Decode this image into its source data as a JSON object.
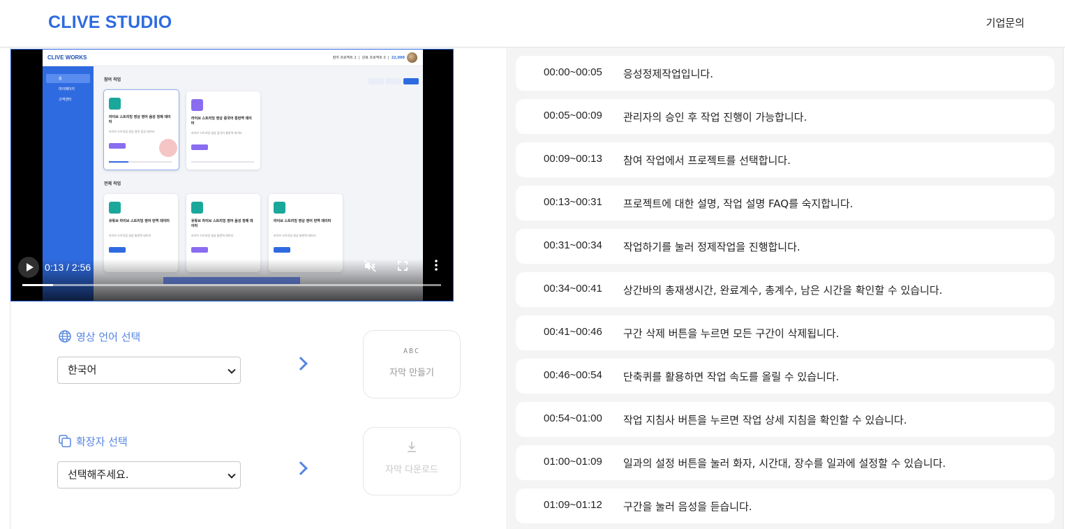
{
  "header": {
    "logo": "CLIVE STUDIO",
    "nav_link": "기업문의"
  },
  "video": {
    "current_time": "0:13",
    "duration": "2:56",
    "time_display": "0:13 / 2:56",
    "progress": 0.074,
    "muted": true,
    "frame": {
      "app_logo": "CLIVE WORKS",
      "top_right": [
        "참여 프로젝트 2",
        "완료 프로젝트 0"
      ],
      "credits": "22,000",
      "sidebar": [
        "홈",
        "마이페이지",
        "고객센터"
      ],
      "section_joined": "참여 작업",
      "section_all": "전체 작업",
      "cards": [
        {
          "title": "라이브 스트리밍 영상 영어 음성 정제 데이터",
          "desc": "라이브 스트리밍 영상 영어 음성 데이터",
          "progress": "31%"
        },
        {
          "title": "라이브 스트리밍 영상 중국어 통번역 데이터",
          "desc": "라이브 스트리밍 영상 중국어 통번역 데이터",
          "progress": "0%"
        },
        {
          "title": "유튜브 라이브 스트리밍 영어 번역 데이터",
          "desc": "라이브 스트리밍 영상 통번역 데이터",
          "progress": "0%"
        },
        {
          "title": "유튜브 라이브 스트리밍 영어 음성 정제 데이터",
          "desc": "라이브 스트리밍 영상 통번역 데이터",
          "progress": "0%"
        },
        {
          "title": "라이브 스트리밍 영상 영어 번역 데이터",
          "desc": "라이브 스트리밍 영상 통번역 데이터",
          "progress": "1%"
        }
      ]
    }
  },
  "language": {
    "label": "영상 언어 선택",
    "selected": "한국어"
  },
  "extension": {
    "label": "확장자 선택",
    "selected": "선택해주세요."
  },
  "actions": {
    "make": {
      "badge": "ABC",
      "label": "자막 만들기"
    },
    "download": {
      "label": "자막 다운로드"
    }
  },
  "subtitles": [
    {
      "time": "00:00~00:05",
      "text": "응성정제작업입니다."
    },
    {
      "time": "00:05~00:09",
      "text": "관리자의 승인 후 작업 진행이 가능합니다."
    },
    {
      "time": "00:09~00:13",
      "text": "참여 작업에서 프로젝트를 선택합니다."
    },
    {
      "time": "00:13~00:31",
      "text": "프로젝트에 대한 설명, 작업 설명 FAQ를 숙지합니다."
    },
    {
      "time": "00:31~00:34",
      "text": "작업하기를 눌러 정제작업을 진행합니다."
    },
    {
      "time": "00:34~00:41",
      "text": "상간바의 총재생시간, 완료계수, 총계수, 남은 시간을 확인할 수 있습니다."
    },
    {
      "time": "00:41~00:46",
      "text": "구간 삭제 버튼을 누르면 모든 구간이 삭제됩니다."
    },
    {
      "time": "00:46~00:54",
      "text": "단축퀴를 활용하면 작업 속도를 올릴 수 있습니다."
    },
    {
      "time": "00:54~01:00",
      "text": "작업 지침사 버튼을 누르면 작업 상세 지침을 확인할 수 있습니다."
    },
    {
      "time": "01:00~01:09",
      "text": "일과의 설정 버튼을 눌러 화자, 시간대, 장수를 일과에 설정할 수 있습니다."
    },
    {
      "time": "01:09~01:12",
      "text": "구간을 눌러 음성을 듣습니다."
    }
  ],
  "colors": {
    "brand": "#2f6be0",
    "accent_label": "#5585e0",
    "list_bg": "#f4f4f5"
  }
}
